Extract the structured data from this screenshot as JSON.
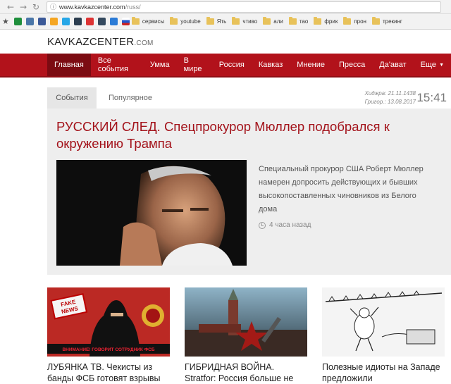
{
  "browser": {
    "url_host": "www.kavkazcenter.com",
    "url_path": "/russ/",
    "bookmarks": [
      "сервисы",
      "youtube",
      "Ять",
      "чтиво",
      "али",
      "тао",
      "фрик",
      "прон",
      "трекинг"
    ]
  },
  "site": {
    "logo_main": "KAVKAZCENTER",
    "logo_suffix": ".COM",
    "nav": [
      "Главная",
      "Все события",
      "Умма",
      "В мире",
      "Россия",
      "Кавказ",
      "Мнение",
      "Пресса",
      "Да'ават",
      "Еще"
    ]
  },
  "tabs": [
    "События",
    "Популярное"
  ],
  "dates": {
    "hijri": "Хиджра: 21.11.1438",
    "gregorian": "Григор.: 13.08.2017",
    "clock": "15:41"
  },
  "feature": {
    "headline": "РУССКИЙ СЛЕД. Спецпрокурор Мюллер подобрался к окружению Трампа",
    "lead": "Специальный прокурор США Роберт Мюллер намерен допросить действующих и бывших высокопоставленных чиновников из Белого дома",
    "time": "4 часа назад"
  },
  "cards": [
    {
      "title": "ЛУБЯНКА ТВ. Чекисты из банды ФСБ готовят взрывы",
      "thumb_badge": "FAKE NEWS",
      "thumb_caption": "ВНИМАНИЕ! ГОВОРИТ СОТРУДНИК ФСБ"
    },
    {
      "title": "ГИБРИДНАЯ ВОЙНА. Stratfor: Россия больше не"
    },
    {
      "title": "Полезные идиоты на Западе предложили"
    }
  ],
  "colors": {
    "brand_red": "#b2121b",
    "headline_red": "#a3121a"
  }
}
